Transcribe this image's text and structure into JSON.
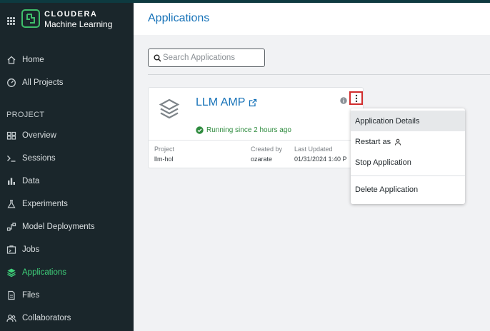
{
  "brand": {
    "name": "CLOUDERA",
    "product": "Machine Learning"
  },
  "nav": {
    "top_items": [
      {
        "label": "Home",
        "icon": "home-icon"
      },
      {
        "label": "All Projects",
        "icon": "gauge-icon"
      }
    ],
    "section_label": "PROJECT",
    "project_items": [
      {
        "label": "Overview",
        "icon": "overview-icon"
      },
      {
        "label": "Sessions",
        "icon": "terminal-icon"
      },
      {
        "label": "Data",
        "icon": "bar-chart-icon"
      },
      {
        "label": "Experiments",
        "icon": "flask-icon"
      },
      {
        "label": "Model Deployments",
        "icon": "model-icon"
      },
      {
        "label": "Jobs",
        "icon": "jobs-icon"
      },
      {
        "label": "Applications",
        "icon": "layers-icon",
        "active": true
      },
      {
        "label": "Files",
        "icon": "file-icon"
      },
      {
        "label": "Collaborators",
        "icon": "people-icon"
      }
    ]
  },
  "page": {
    "title": "Applications"
  },
  "search": {
    "placeholder": "Search Applications",
    "value": ""
  },
  "app_card": {
    "name": "LLM AMP",
    "status": "Running since 2 hours ago",
    "project_label": "Project",
    "project_value": "llm-hol",
    "created_by_label": "Created by",
    "created_by_value": "ozarate",
    "last_updated_label": "Last Updated",
    "last_updated_value": "01/31/2024 1:40 P"
  },
  "menu": {
    "items": [
      "Application Details",
      "Restart as",
      "Stop Application",
      "Delete Application"
    ]
  },
  "colors": {
    "accent": "#1672b8",
    "active_nav": "#3fd17a",
    "sidebar_bg": "#1a262b",
    "status_green": "#2e8b3e",
    "highlight_border": "#d12d2d"
  }
}
